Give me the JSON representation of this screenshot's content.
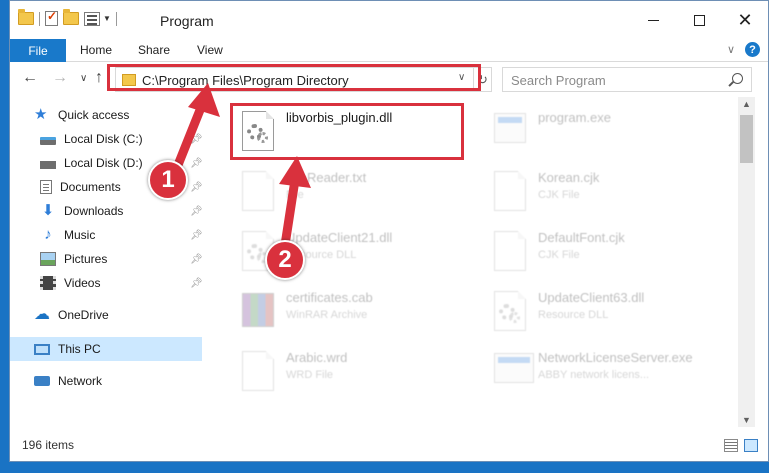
{
  "window": {
    "title": "Program"
  },
  "ribbon": {
    "tabs": [
      "File",
      "Home",
      "Share",
      "View"
    ]
  },
  "address": {
    "path": "C:\\Program Files\\Program Directory"
  },
  "search": {
    "placeholder": "Search Program"
  },
  "sidebar": {
    "items": [
      {
        "label": "Quick access",
        "icon": "star-icon"
      },
      {
        "label": "Local Disk (C:)",
        "icon": "disk-icon",
        "pinned": true
      },
      {
        "label": "Local Disk (D:)",
        "icon": "disk-icon",
        "pinned": true
      },
      {
        "label": "Documents",
        "icon": "document-icon",
        "pinned": true
      },
      {
        "label": "Downloads",
        "icon": "download-icon",
        "pinned": true
      },
      {
        "label": "Music",
        "icon": "music-icon",
        "pinned": true
      },
      {
        "label": "Pictures",
        "icon": "pictures-icon",
        "pinned": true
      },
      {
        "label": "Videos",
        "icon": "videos-icon",
        "pinned": true
      },
      {
        "label": "OneDrive",
        "icon": "cloud-icon"
      },
      {
        "label": "This PC",
        "icon": "computer-icon",
        "selected": true
      },
      {
        "label": "Network",
        "icon": "network-icon"
      }
    ]
  },
  "files": [
    {
      "name": "libvorbis_plugin.dll",
      "type": "",
      "icon": "gear-file-icon",
      "highlighted": true
    },
    {
      "name": "program.exe",
      "type": "",
      "icon": "exe-icon"
    },
    {
      "name": "FileReader.txt",
      "type": "File",
      "icon": "file-icon"
    },
    {
      "name": "Korean.cjk",
      "type": "CJK File",
      "icon": "file-icon"
    },
    {
      "name": "UpdateClient21.dll",
      "type": "Resource DLL",
      "icon": "gear-file-icon"
    },
    {
      "name": "DefaultFont.cjk",
      "type": "CJK File",
      "icon": "file-icon"
    },
    {
      "name": "certificates.cab",
      "type": "WinRAR Archive",
      "icon": "archive-icon"
    },
    {
      "name": "UpdateClient63.dll",
      "type": "Resource DLL",
      "icon": "gear-file-icon"
    },
    {
      "name": "Arabic.wrd",
      "type": "WRD File",
      "icon": "file-icon"
    },
    {
      "name": "NetworkLicenseServer.exe",
      "type": "ABBY network licens...",
      "icon": "exe-icon"
    }
  ],
  "status": {
    "count": "196 items"
  },
  "callouts": [
    "1",
    "2"
  ],
  "colors": {
    "accent": "#1979ca",
    "highlight": "#d9313d",
    "selected": "#cce8ff"
  }
}
